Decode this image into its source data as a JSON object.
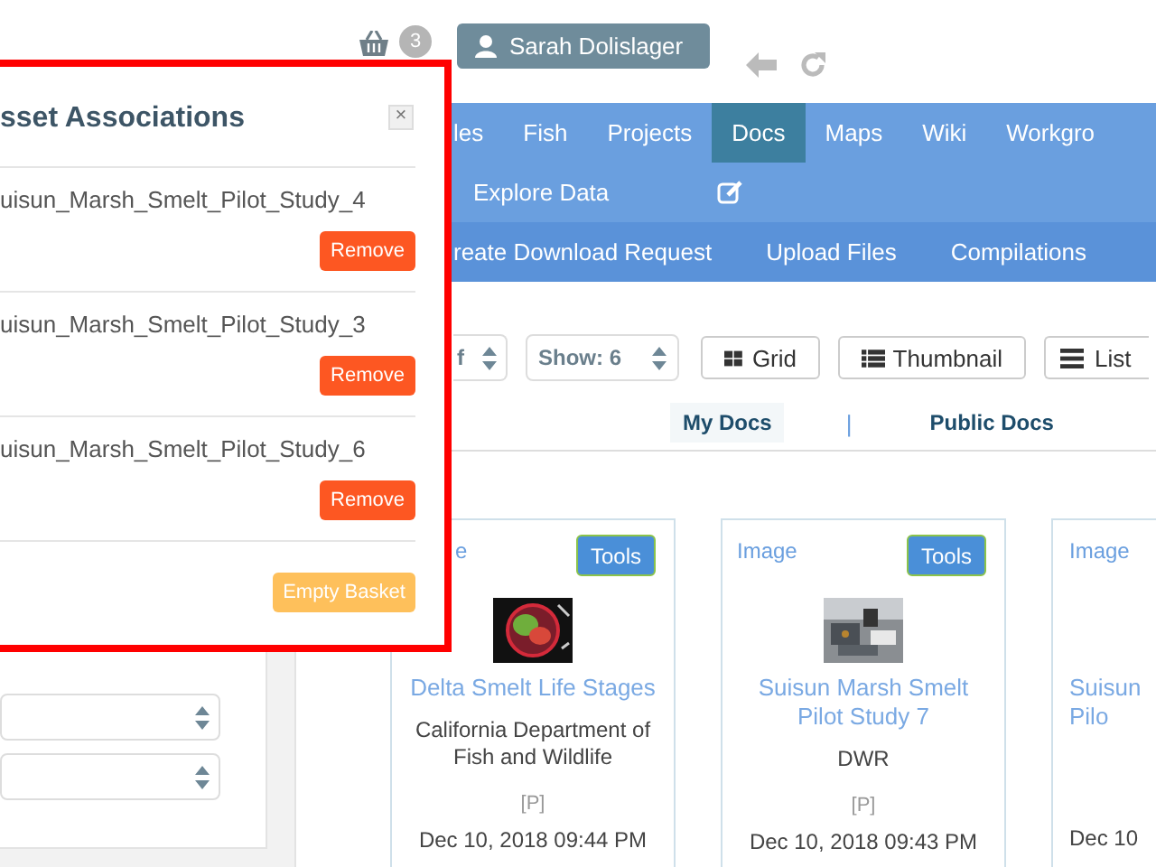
{
  "header": {
    "basket_count": "3",
    "user": "Sarah Dolislager"
  },
  "nav": {
    "main": [
      {
        "label": "les",
        "selected": false
      },
      {
        "label": "Fish",
        "selected": false
      },
      {
        "label": "Projects",
        "selected": false
      },
      {
        "label": "Docs",
        "selected": true
      },
      {
        "label": "Maps",
        "selected": false
      },
      {
        "label": "Wiki",
        "selected": false
      },
      {
        "label": "Workgro",
        "selected": false
      }
    ],
    "secondary": [
      {
        "kind": "link",
        "label": "Explore Data"
      },
      {
        "kind": "edit"
      }
    ],
    "sub": [
      "reate Download Request",
      "Upload Files",
      "Compilations"
    ]
  },
  "sidebar": {
    "filters": [
      {
        "kind": "select"
      },
      {
        "kind": "select"
      }
    ]
  },
  "toolbar": {
    "sort_select": "f",
    "show_select": "Show: 6",
    "views": [
      {
        "kind": "grid",
        "label": "Grid"
      },
      {
        "kind": "thumbnail",
        "label": "Thumbnail"
      },
      {
        "kind": "list",
        "label": "List"
      }
    ]
  },
  "doc_tabs": {
    "tabs": [
      {
        "label": "My Docs",
        "selected": true
      },
      {
        "label": "Public Docs",
        "selected": false
      }
    ],
    "separator": "|"
  },
  "cards": [
    {
      "type": "e",
      "tools": "Tools",
      "kind": "picture",
      "title": "Delta Smelt Life Stages",
      "org": "California Department of Fish and Wildlife",
      "access": "[P]",
      "date": "Dec 10, 2018 09:44 PM"
    },
    {
      "type": "Image",
      "tools": "Tools",
      "kind": "picture",
      "title": "Suisun Marsh Smelt Pilot Study 7",
      "org": "DWR",
      "access": "[P]",
      "date": "Dec 10, 2018 09:43 PM"
    },
    {
      "type": "Image",
      "title": "Suisun Pilo",
      "date": "Dec 10"
    }
  ],
  "basket_popup": {
    "title": "sset Associations",
    "close": "×",
    "items": [
      {
        "name": "uisun_Marsh_Smelt_Pilot_Study_4",
        "action": "Remove"
      },
      {
        "name": "uisun_Marsh_Smelt_Pilot_Study_3",
        "action": "Remove"
      },
      {
        "name": "uisun_Marsh_Smelt_Pilot_Study_6",
        "action": "Remove"
      }
    ],
    "empty_button": "Empty Basket"
  }
}
